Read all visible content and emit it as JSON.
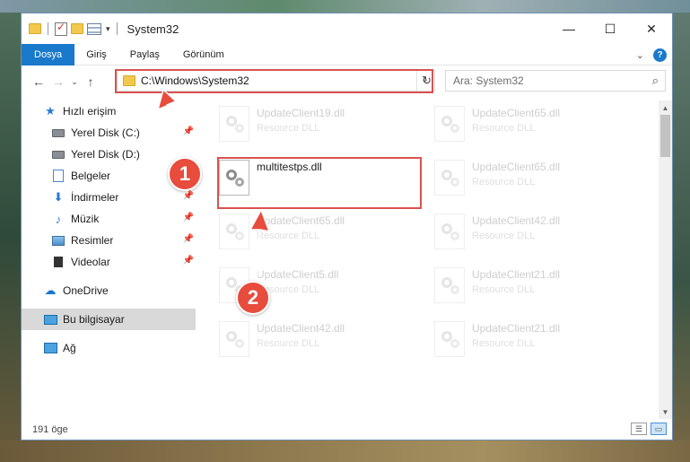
{
  "window": {
    "title": "System32",
    "caption": {
      "minimize": "—",
      "maximize": "☐",
      "close": "✕"
    }
  },
  "quick_access_toolbar": {
    "dropdown": "▾"
  },
  "ribbon": {
    "tabs": [
      "Dosya",
      "Giriş",
      "Paylaş",
      "Görünüm"
    ],
    "collapse": "⌄",
    "help": "?"
  },
  "nav": {
    "back": "←",
    "forward": "→",
    "recent": "⌄",
    "up": "↑",
    "address": "C:\\Windows\\System32",
    "address_dropdown": "⌄",
    "refresh": "↻",
    "search_placeholder": "Ara: System32",
    "search_icon": "⌕"
  },
  "sidebar": {
    "quick_access": {
      "label": "Hızlı erişim",
      "items": [
        {
          "label": "Yerel Disk (C:)",
          "icon": "drive-icon",
          "pinned": true
        },
        {
          "label": "Yerel Disk (D:)",
          "icon": "drive-icon",
          "pinned": false
        },
        {
          "label": "Belgeler",
          "icon": "documents-icon",
          "pinned": true
        },
        {
          "label": "İndirmeler",
          "icon": "download-icon",
          "pinned": true
        },
        {
          "label": "Müzik",
          "icon": "music-icon",
          "pinned": true
        },
        {
          "label": "Resimler",
          "icon": "pictures-icon",
          "pinned": true
        },
        {
          "label": "Videolar",
          "icon": "videos-icon",
          "pinned": true
        }
      ]
    },
    "onedrive": "OneDrive",
    "this_pc": "Bu bilgisayar",
    "network": "Ağ"
  },
  "files": [
    {
      "name": "UpdateClient19.dll",
      "type": "Resource DLL",
      "faded": true
    },
    {
      "name": "UpdateClient65.dll",
      "type": "Resource DLL",
      "faded": true
    },
    {
      "name": "multitestps.dll",
      "type": "",
      "faded": false
    },
    {
      "name": "UpdateClient65.dll",
      "type": "Resource DLL",
      "faded": true
    },
    {
      "name": "UpdateClient65.dll",
      "type": "Resource DLL",
      "faded": true
    },
    {
      "name": "UpdateClient42.dll",
      "type": "Resource DLL",
      "faded": true
    },
    {
      "name": "UpdateClient5.dll",
      "type": "Resource DLL",
      "faded": true
    },
    {
      "name": "UpdateClient21.dll",
      "type": "Resource DLL",
      "faded": true
    },
    {
      "name": "UpdateClient42.dll",
      "type": "Resource DLL",
      "faded": true
    },
    {
      "name": "UpdateClient21.dll",
      "type": "Resource DLL",
      "faded": true
    }
  ],
  "scrollbar": {
    "up": "▲",
    "down": "▼"
  },
  "status": {
    "count": "191 öge"
  },
  "annotations": {
    "badge_1": "1",
    "badge_2": "2",
    "color": "#e74c3c"
  },
  "colors": {
    "accent": "#1979ca",
    "highlight": "#d9534f"
  }
}
